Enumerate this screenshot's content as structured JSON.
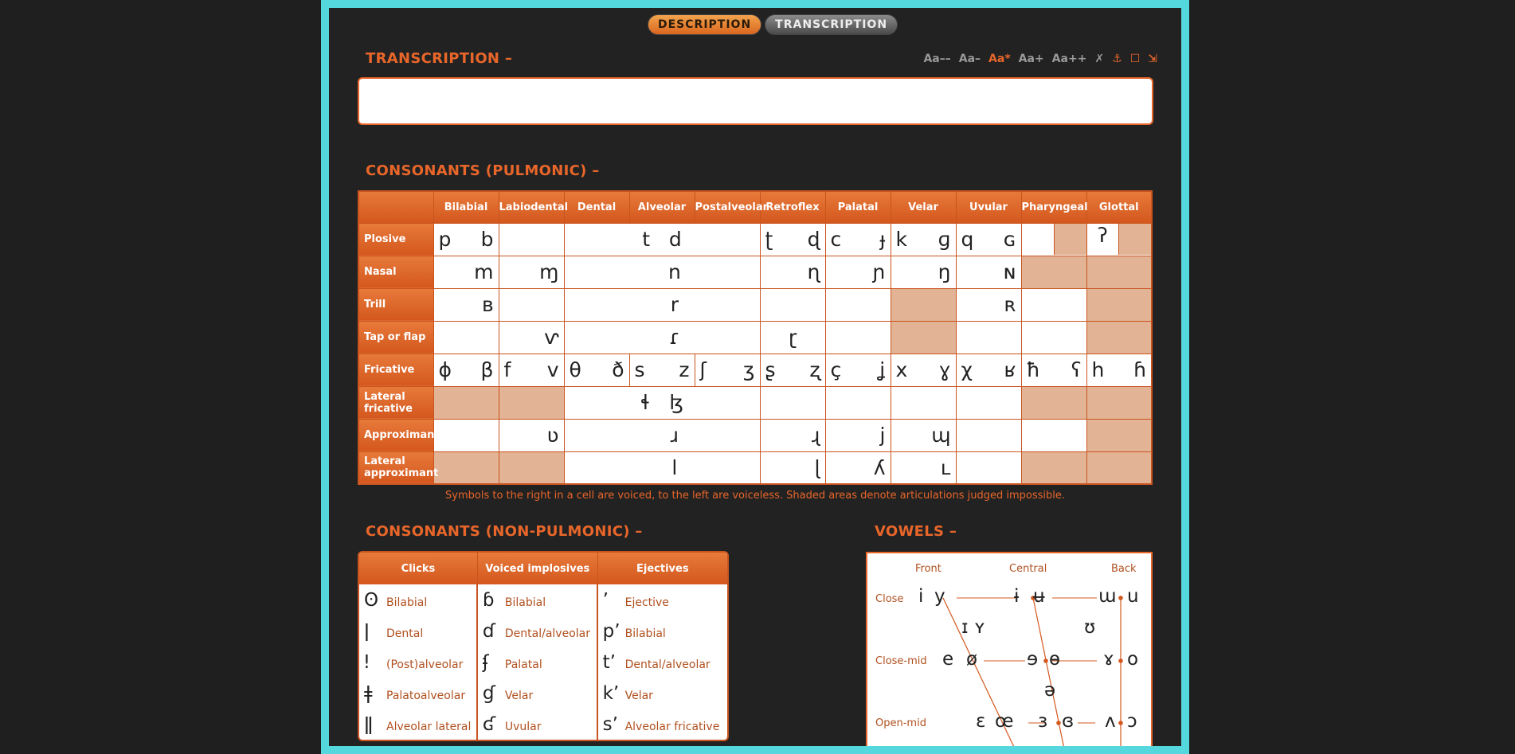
{
  "tabs": {
    "description": "DESCRIPTION",
    "transcription": "TRANSCRIPTION"
  },
  "transcription": {
    "title": "TRANSCRIPTION –",
    "value": ""
  },
  "font_sizes": [
    "Aa––",
    "Aa–",
    "Aa*",
    "Aa+",
    "Aa++"
  ],
  "controls": {
    "clear": "✗",
    "anchor": "⚓",
    "box": "☐",
    "resize": "⇲"
  },
  "pulmonic": {
    "title": "CONSONANTS (PULMONIC) –",
    "columns": [
      "Bilabial",
      "Labiodental",
      "Dental",
      "Alveolar",
      "Postalveolar",
      "Retroflex",
      "Palatal",
      "Velar",
      "Uvular",
      "Pharyngeal",
      "Glottal"
    ],
    "rows": [
      {
        "label": "Plosive",
        "bilabial": [
          "p",
          "b"
        ],
        "alveolar": [
          "t",
          "d"
        ],
        "retroflex": [
          "ʈ",
          "ɖ"
        ],
        "palatal": [
          "c",
          "ɟ"
        ],
        "velar": [
          "k",
          "ɡ"
        ],
        "uvular": [
          "q",
          "ɢ"
        ],
        "glottal": [
          "ʔ"
        ]
      },
      {
        "label": "Nasal",
        "bilabial": "m",
        "labiodental": "ɱ",
        "alveolar": "n",
        "retroflex": "ɳ",
        "palatal": "ɲ",
        "velar": "ŋ",
        "uvular": "ɴ"
      },
      {
        "label": "Trill",
        "bilabial": "ʙ",
        "alveolar": "r",
        "uvular": "ʀ"
      },
      {
        "label": "Tap or flap",
        "labiodental": "ⱱ",
        "alveolar": "ɾ",
        "retroflex": "ɽ"
      },
      {
        "label": "Fricative",
        "bilabial": [
          "ɸ",
          "β"
        ],
        "labiodental": [
          "f",
          "v"
        ],
        "dental": [
          "θ",
          "ð"
        ],
        "alveolar": [
          "s",
          "z"
        ],
        "postalveolar": [
          "ʃ",
          "ʒ"
        ],
        "retroflex": [
          "ʂ",
          "ʐ"
        ],
        "palatal": [
          "ç",
          "ʝ"
        ],
        "velar": [
          "x",
          "ɣ"
        ],
        "uvular": [
          "χ",
          "ʁ"
        ],
        "pharyngeal": [
          "ħ",
          "ʕ"
        ],
        "glottal": [
          "h",
          "ɦ"
        ]
      },
      {
        "label": "Lateral fricative",
        "alveolar": [
          "ɬ",
          "ɮ"
        ]
      },
      {
        "label": "Approximant",
        "labiodental": "ʋ",
        "alveolar": "ɹ",
        "retroflex": "ɻ",
        "palatal": "j",
        "velar": "ɰ"
      },
      {
        "label": "Lateral approximant",
        "alveolar": "l",
        "retroflex": "ɭ",
        "palatal": "ʎ",
        "velar": "ʟ"
      }
    ],
    "note": "Symbols to the right in a cell are voiced, to the left are voiceless. Shaded areas denote articulations judged impossible."
  },
  "nonpulmonic": {
    "title": "CONSONANTS (NON-PULMONIC) –",
    "headers": [
      "Clicks",
      "Voiced implosives",
      "Ejectives"
    ],
    "rows": [
      [
        {
          "g": "ʘ",
          "d": "Bilabial"
        },
        {
          "g": "ɓ",
          "d": "Bilabial"
        },
        {
          "g": "ʼ",
          "d": "Ejective"
        }
      ],
      [
        {
          "g": "ǀ",
          "d": "Dental"
        },
        {
          "g": "ɗ",
          "d": "Dental/alveolar"
        },
        {
          "g": "pʼ",
          "d": "Bilabial"
        }
      ],
      [
        {
          "g": "ǃ",
          "d": "(Post)alveolar"
        },
        {
          "g": "ʄ",
          "d": "Palatal"
        },
        {
          "g": "tʼ",
          "d": "Dental/alveolar"
        }
      ],
      [
        {
          "g": "ǂ",
          "d": "Palatoalveolar"
        },
        {
          "g": "ɠ",
          "d": "Velar"
        },
        {
          "g": "kʼ",
          "d": "Velar"
        }
      ],
      [
        {
          "g": "ǁ",
          "d": "Alveolar lateral"
        },
        {
          "g": "ʛ",
          "d": "Uvular"
        },
        {
          "g": "sʼ",
          "d": "Alveolar fricative"
        }
      ]
    ]
  },
  "vowels": {
    "title": "VOWELS –",
    "columns": [
      "Front",
      "Central",
      "Back"
    ],
    "rows": [
      "Close",
      "Close-mid",
      "Open-mid"
    ],
    "symbols": {
      "close": [
        "i",
        "y",
        "ɨ",
        "ʉ",
        "ɯ",
        "u"
      ],
      "near_close": [
        "ɪ",
        "ʏ",
        "ʊ"
      ],
      "close_mid": [
        "e",
        "ø",
        "ɘ",
        "ɵ",
        "ɤ",
        "o"
      ],
      "mid": [
        "ə"
      ],
      "open_mid": [
        "ɛ",
        "œ",
        "ɜ",
        "ɞ",
        "ʌ",
        "ɔ"
      ]
    }
  },
  "colors": {
    "accent": "#e8662a",
    "frame": "#55d8dd",
    "background": "#222222",
    "shaded": "#e2b394"
  }
}
